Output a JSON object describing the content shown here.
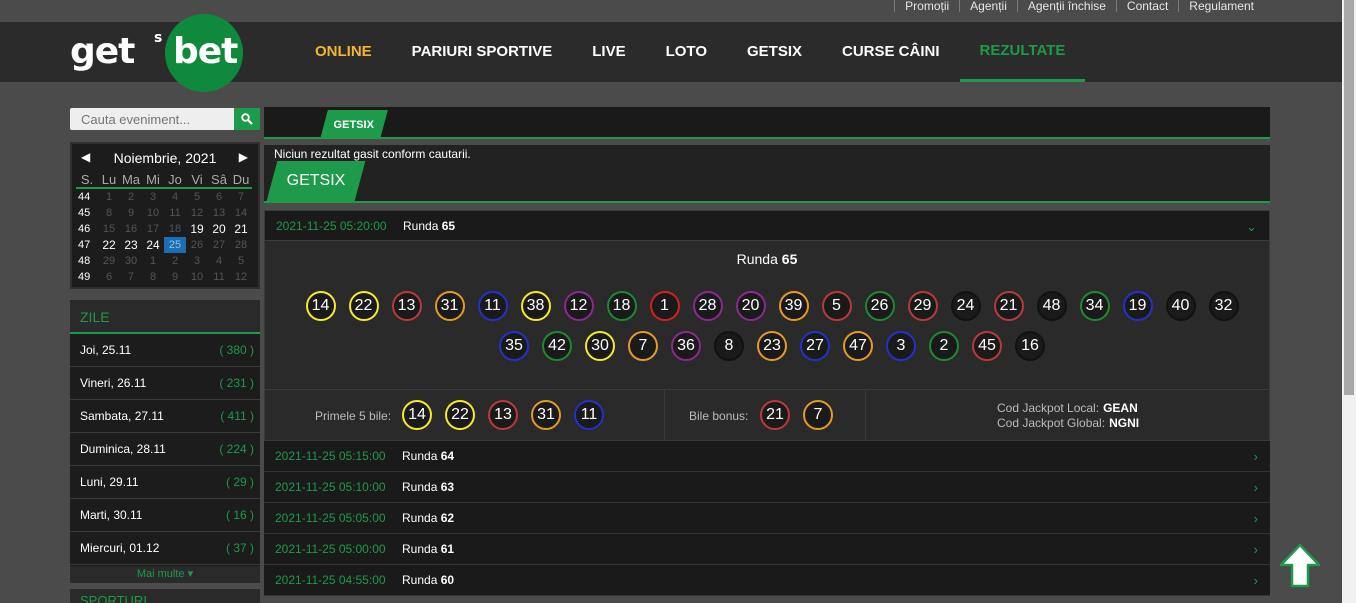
{
  "toplinks": [
    "Promoții",
    "Agenții",
    "Agenții închise",
    "Contact",
    "Regulament"
  ],
  "logo": {
    "left": "get",
    "mark": "s",
    "right": "bet"
  },
  "nav": [
    "ONLINE",
    "PARIURI SPORTIVE",
    "LIVE",
    "LOTO",
    "GETSIX",
    "CURSE CÂINI",
    "REZULTATE"
  ],
  "search": {
    "placeholder": "Cauta eveniment..."
  },
  "calendar": {
    "month": "Noiembrie, 2021",
    "days": [
      "S.",
      "Lu",
      "Ma",
      "Mi",
      "Jo",
      "Vi",
      "Sâ",
      "Du"
    ],
    "weeks": [
      {
        "wk": "44",
        "d": [
          "1",
          "2",
          "3",
          "4",
          "5",
          "6",
          "7"
        ]
      },
      {
        "wk": "45",
        "d": [
          "8",
          "9",
          "10",
          "11",
          "12",
          "13",
          "14"
        ]
      },
      {
        "wk": "46",
        "d": [
          "15",
          "16",
          "17",
          "18",
          "19",
          "20",
          "21"
        ]
      },
      {
        "wk": "47",
        "d": [
          "22",
          "23",
          "24",
          "25",
          "26",
          "27",
          "28"
        ]
      },
      {
        "wk": "48",
        "d": [
          "29",
          "30",
          "1",
          "2",
          "3",
          "4",
          "5"
        ]
      },
      {
        "wk": "49",
        "d": [
          "6",
          "7",
          "8",
          "9",
          "10",
          "11",
          "12"
        ]
      }
    ]
  },
  "zile": {
    "title": "ZILE",
    "items": [
      {
        "label": "Joi, 25.11",
        "count": "( 380 )"
      },
      {
        "label": "Vineri, 26.11",
        "count": "( 231 )"
      },
      {
        "label": "Sambata, 27.11",
        "count": "( 411 )"
      },
      {
        "label": "Duminica, 28.11",
        "count": "( 224 )"
      },
      {
        "label": "Luni, 29.11",
        "count": "( 29 )"
      },
      {
        "label": "Marti, 30.11",
        "count": "( 16 )"
      },
      {
        "label": "Miercuri, 01.12",
        "count": "( 37 )"
      }
    ],
    "more": "Mai multe ▾",
    "next_section": "SPORTURI"
  },
  "main": {
    "tab": "GETSIX",
    "no_results": "Niciun rezultat gasit conform cautarii.",
    "section": "GETSIX"
  },
  "open_round": {
    "date": "2021-11-25 05:20:00",
    "runda_label": "Runda",
    "runda_num": "65",
    "balls": [
      {
        "n": "14",
        "c": "y"
      },
      {
        "n": "22",
        "c": "y"
      },
      {
        "n": "13",
        "c": "r"
      },
      {
        "n": "31",
        "c": "o"
      },
      {
        "n": "11",
        "c": "b"
      },
      {
        "n": "38",
        "c": "y"
      },
      {
        "n": "12",
        "c": "p"
      },
      {
        "n": "18",
        "c": "g"
      },
      {
        "n": "1",
        "c": "rr"
      },
      {
        "n": "28",
        "c": "p"
      },
      {
        "n": "20",
        "c": "p"
      },
      {
        "n": "39",
        "c": "o"
      },
      {
        "n": "5",
        "c": "r"
      },
      {
        "n": "26",
        "c": "g"
      },
      {
        "n": "29",
        "c": "r"
      },
      {
        "n": "24",
        "c": "k"
      },
      {
        "n": "21",
        "c": "r"
      },
      {
        "n": "48",
        "c": "k"
      },
      {
        "n": "34",
        "c": "g"
      },
      {
        "n": "19",
        "c": "b"
      },
      {
        "n": "40",
        "c": "k"
      },
      {
        "n": "32",
        "c": "k"
      },
      {
        "n": "35",
        "c": "b"
      },
      {
        "n": "42",
        "c": "g"
      },
      {
        "n": "30",
        "c": "y"
      },
      {
        "n": "7",
        "c": "o"
      },
      {
        "n": "36",
        "c": "p"
      },
      {
        "n": "8",
        "c": "k"
      },
      {
        "n": "23",
        "c": "o"
      },
      {
        "n": "27",
        "c": "b"
      },
      {
        "n": "47",
        "c": "o"
      },
      {
        "n": "3",
        "c": "b"
      },
      {
        "n": "2",
        "c": "g"
      },
      {
        "n": "45",
        "c": "r"
      },
      {
        "n": "16",
        "c": "k"
      }
    ],
    "first5_label": "Primele 5 bile:",
    "first5": [
      {
        "n": "14",
        "c": "y"
      },
      {
        "n": "22",
        "c": "y"
      },
      {
        "n": "13",
        "c": "r"
      },
      {
        "n": "31",
        "c": "o"
      },
      {
        "n": "11",
        "c": "b"
      }
    ],
    "bonus_label": "Bile bonus:",
    "bonus": [
      {
        "n": "21",
        "c": "r"
      },
      {
        "n": "7",
        "c": "o"
      }
    ],
    "jackpot_local_label": "Cod Jackpot Local:",
    "jackpot_local": "GEAN",
    "jackpot_global_label": "Cod Jackpot Global:",
    "jackpot_global": "NGNI"
  },
  "rounds": [
    {
      "date": "2021-11-25 05:15:00",
      "num": "64"
    },
    {
      "date": "2021-11-25 05:10:00",
      "num": "63"
    },
    {
      "date": "2021-11-25 05:05:00",
      "num": "62"
    },
    {
      "date": "2021-11-25 05:00:00",
      "num": "61"
    },
    {
      "date": "2021-11-25 04:55:00",
      "num": "60"
    }
  ],
  "colors": {
    "accent": "#1d9a4a",
    "online": "#f2b632",
    "selected_day": "#1b6fb0"
  }
}
